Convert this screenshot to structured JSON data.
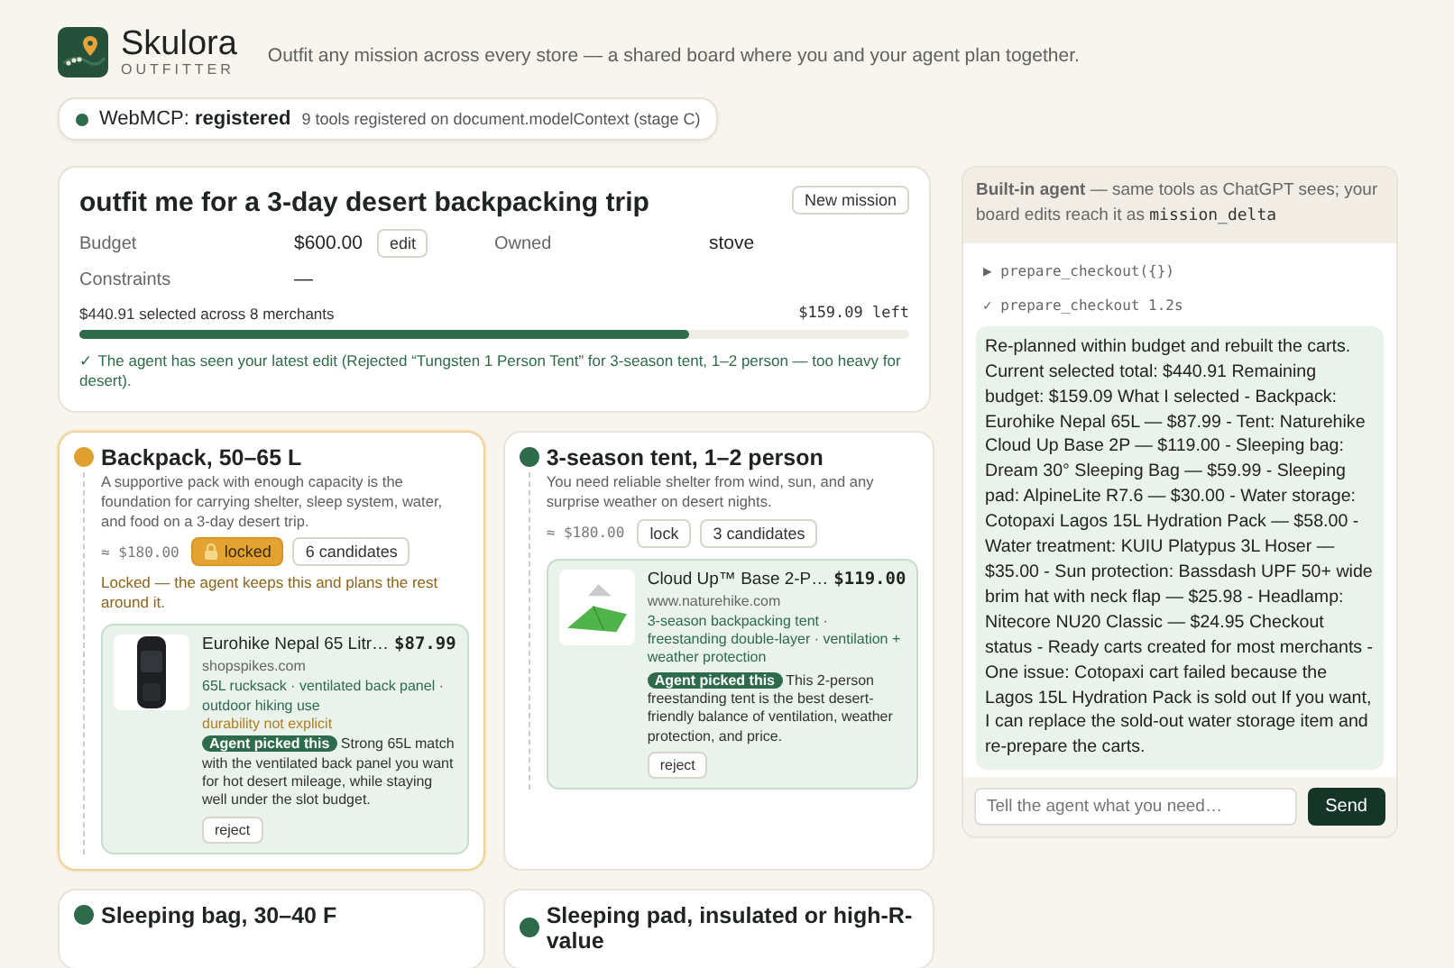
{
  "brand": {
    "name": "Skulora",
    "subtitle": "OUTFITTER",
    "tagline": "Outfit any mission across every store — a shared board where you and your agent plan together."
  },
  "status": {
    "label": "WebMCP:",
    "value": "registered",
    "detail": "9 tools registered on document.modelContext (stage C)",
    "on": true
  },
  "mission": {
    "title": "outfit me for a 3-day desert backpacking trip",
    "new_button": "New mission",
    "fields": [
      {
        "label": "Budget",
        "value": "$600.00",
        "action": "edit"
      },
      {
        "label": "Owned",
        "value": "stove"
      },
      {
        "label": "Constraints",
        "value": "—"
      }
    ],
    "selected_text": "$440.91 selected across 8 merchants",
    "left_text": "$159.09 left",
    "level": 0.735,
    "note": "✓ The agent has seen your latest edit (Rejected “Tungsten 1 Person Tent” for 3-season tent, 1–2 person — too heavy for desert)."
  },
  "slots": [
    {
      "title": "Backpack, 50–65 L",
      "color": "#e0a030",
      "locked": true,
      "description": "A supportive pack with enough capacity is the foundation for carrying shelter, sleep system, water, and food on a 3-day desert trip.",
      "estimate": "≈ $180.00",
      "lock_label": "locked",
      "candidates": "6 candidates",
      "lock_note": "Locked — the agent keeps this and plans the rest around it.",
      "pick": {
        "kind": "backpack",
        "name": "Eurohike Nepal 65 Litr…",
        "price": "$87.99",
        "domain": "shopspikes.com",
        "tags": "65L rucksack · ventilated back panel · outdoor hiking use",
        "caveat": "durability not explicit",
        "badge": "Agent picked this",
        "reason": "Strong 65L match with the ventilated back panel you want for hot desert mileage, while staying well under the slot budget.",
        "reject": "reject"
      }
    },
    {
      "title": "3-season tent, 1–2 person",
      "color": "#2e6b4c",
      "locked": false,
      "description": "You need reliable shelter from wind, sun, and any surprise weather on desert nights.",
      "estimate": "≈ $180.00",
      "lock_label": "lock",
      "candidates": "3 candidates",
      "pick": {
        "kind": "tent",
        "name": "Cloud Up™ Base 2-P…",
        "price": "$119.00",
        "domain": "www.naturehike.com",
        "tags": "3-season backpacking tent · freestanding double-layer · ventilation + weather protection",
        "badge": "Agent picked this",
        "reason": "This 2-person freestanding tent is the best desert-friendly balance of ventilation, weather protection, and price.",
        "reject": "reject"
      }
    },
    {
      "title": "Sleeping bag, 30–40 F",
      "color": "#2e6b4c",
      "locked": false
    },
    {
      "title": "Sleeping pad, insulated or high-R-value",
      "color": "#2e6b4c",
      "locked": false
    }
  ],
  "agent": {
    "header": "**Built-in agent** — same tools as ChatGPT sees; your board edits reach it as",
    "header_code": "mission_delta",
    "tool_lines": [
      "▶ prepare_checkout({})",
      "✓ prepare_checkout 1.2s"
    ],
    "message": "Re-planned within budget and rebuilt the carts. Current selected total: $440.91 Remaining budget: $159.09 What I selected - Backpack: Eurohike Nepal 65L — $87.99 - Tent: Naturehike Cloud Up Base 2P — $119.00 - Sleeping bag: Dream 30° Sleeping Bag — $59.99 - Sleeping pad: AlpineLite R7.6 — $30.00 - Water storage: Cotopaxi Lagos 15L Hydration Pack — $58.00 - Water treatment: KUIU Platypus 3L Hoser — $35.00 - Sun protection: Bassdash UPF 50+ wide brim hat with neck flap — $25.98 - Headlamp: Nitecore NU20 Classic — $24.95 Checkout status - Ready carts created for most merchants - One issue: Cotopaxi cart failed because the Lagos 15L Hydration Pack is sold out If you want, I can replace the sold-out water storage item and re-prepare the carts.",
    "placeholder": "Tell the agent what you need…",
    "send": "Send"
  }
}
